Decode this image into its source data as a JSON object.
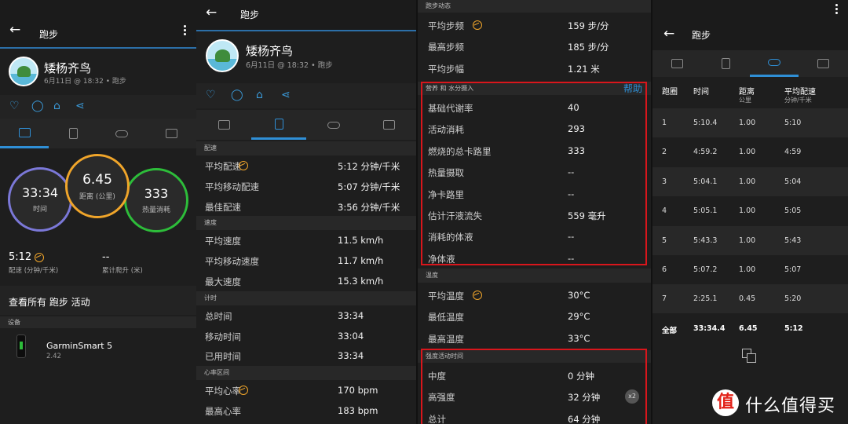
{
  "colors": {
    "accent": "#2f8fd6",
    "orange": "#f0a52a",
    "green": "#2dbd3a",
    "purple": "#7b78d8",
    "red": "#d9161c"
  },
  "panel1": {
    "title": "跑步",
    "user": "矮杨齐鸟",
    "subtitle": "6月11日 @ 18:32 • 跑步",
    "time_value": "33:34",
    "time_label": "时间",
    "distance_value": "6.45",
    "distance_label": "距离 (公里)",
    "calories_value": "333",
    "calories_label": "热量消耗",
    "pace_value": "5:12",
    "pace_label": "配速 (分钟/千米)",
    "ascent_value": "--",
    "ascent_label": "累计爬升 (米)",
    "view_all": "查看所有 跑步 活动",
    "devices_header": "设备",
    "device_name": "GarminSmart 5",
    "device_version": "2.42"
  },
  "panel2": {
    "title": "跑步",
    "user": "矮杨齐鸟",
    "subtitle": "6月11日 @ 18:32 • 跑步",
    "sections": [
      {
        "header": "配速",
        "rows": [
          {
            "label": "平均配速",
            "value": "5:12 分钟/千米",
            "gauge": true
          },
          {
            "label": "平均移动配速",
            "value": "5:07 分钟/千米"
          },
          {
            "label": "最佳配速",
            "value": "3:56 分钟/千米"
          }
        ]
      },
      {
        "header": "速度",
        "rows": [
          {
            "label": "平均速度",
            "value": "11.5 km/h"
          },
          {
            "label": "平均移动速度",
            "value": "11.7 km/h"
          },
          {
            "label": "最大速度",
            "value": "15.3 km/h"
          }
        ]
      },
      {
        "header": "计时",
        "rows": [
          {
            "label": "总时间",
            "value": "33:34"
          },
          {
            "label": "移动时间",
            "value": "33:04"
          },
          {
            "label": "已用时间",
            "value": "33:34"
          }
        ]
      },
      {
        "header": "心率区间",
        "rows": [
          {
            "label": "平均心率",
            "value": "170 bpm",
            "gauge": true
          },
          {
            "label": "最高心率",
            "value": "183 bpm"
          }
        ]
      }
    ]
  },
  "panel3": {
    "top_header": "跑步动态",
    "dynamics": [
      {
        "label": "平均步频",
        "value": "159 步/分",
        "gauge": true
      },
      {
        "label": "最高步频",
        "value": "185 步/分"
      },
      {
        "label": "平均步幅",
        "value": "1.21 米"
      }
    ],
    "nutrition_header": "营养 和 水分摄入",
    "help": "帮助",
    "nutrition": [
      {
        "label": "基础代谢率",
        "value": "40"
      },
      {
        "label": "活动消耗",
        "value": "293"
      },
      {
        "label": "燃烧的总卡路里",
        "value": "333"
      },
      {
        "label": "热量摄取",
        "value": "--"
      },
      {
        "label": "净卡路里",
        "value": "--"
      },
      {
        "label": "估计汗液流失",
        "value": "559 毫升"
      },
      {
        "label": "消耗的体液",
        "value": "--"
      },
      {
        "label": "净体液",
        "value": "--"
      }
    ],
    "temp_header": "温度",
    "temps": [
      {
        "label": "平均温度",
        "value": "30°C",
        "gauge": true
      },
      {
        "label": "最低温度",
        "value": "29°C"
      },
      {
        "label": "最高温度",
        "value": "33°C"
      }
    ],
    "intensity_header": "强度活动时间",
    "intensity": [
      {
        "label": "中度",
        "value": "0 分钟"
      },
      {
        "label": "高强度",
        "value": "32 分钟",
        "badge": "x2"
      },
      {
        "label": "总计",
        "value": "64 分钟"
      }
    ]
  },
  "panel4": {
    "title": "跑步",
    "headers": {
      "lap": "跑圈",
      "time": "时间",
      "dist": "距离",
      "dist_unit": "公里",
      "pace": "平均配速",
      "pace_unit": "分钟/千米"
    },
    "laps": [
      {
        "lap": "1",
        "time": "5:10.4",
        "dist": "1.00",
        "pace": "5:10"
      },
      {
        "lap": "2",
        "time": "4:59.2",
        "dist": "1.00",
        "pace": "4:59"
      },
      {
        "lap": "3",
        "time": "5:04.1",
        "dist": "1.00",
        "pace": "5:04"
      },
      {
        "lap": "4",
        "time": "5:05.1",
        "dist": "1.00",
        "pace": "5:05"
      },
      {
        "lap": "5",
        "time": "5:43.3",
        "dist": "1.00",
        "pace": "5:43"
      },
      {
        "lap": "6",
        "time": "5:07.2",
        "dist": "1.00",
        "pace": "5:07"
      },
      {
        "lap": "7",
        "time": "2:25.1",
        "dist": "0.45",
        "pace": "5:20"
      }
    ],
    "total": {
      "lap": "全部",
      "time": "33:34.4",
      "dist": "6.45",
      "pace": "5:12"
    }
  },
  "watermark": {
    "badge": "值",
    "text": "什么值得买"
  }
}
